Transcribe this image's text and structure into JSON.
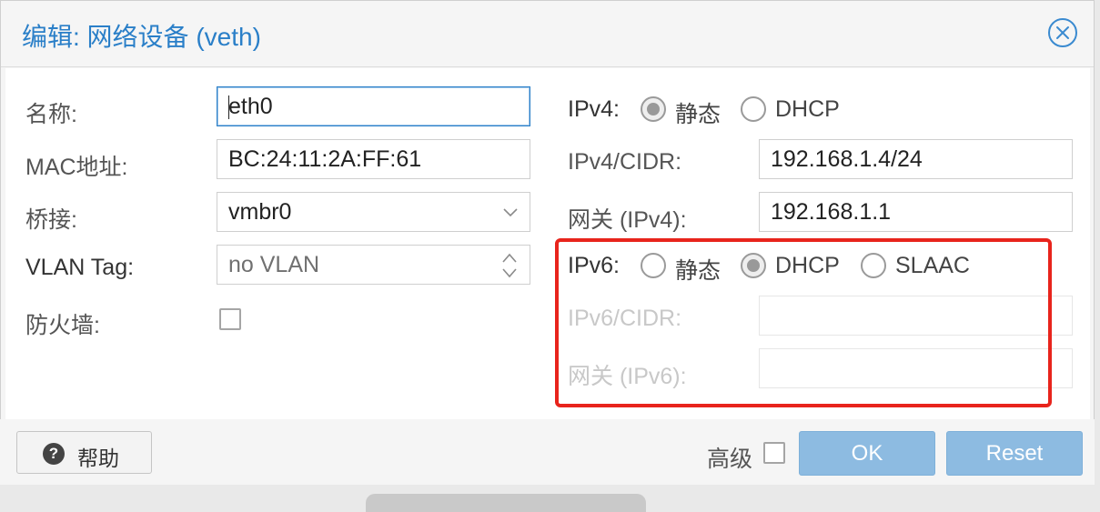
{
  "dialog": {
    "title": "编辑: 网络设备 (veth)"
  },
  "left": {
    "name_label": "名称:",
    "name_value": "eth0",
    "mac_label": "MAC地址:",
    "mac_value": "BC:24:11:2A:FF:61",
    "bridge_label": "桥接:",
    "bridge_value": "vmbr0",
    "vlan_label": "VLAN Tag:",
    "vlan_placeholder": "no VLAN",
    "firewall_label": "防火墙:",
    "firewall_checked": false
  },
  "ipv4": {
    "label": "IPv4:",
    "options": [
      "静态",
      "DHCP"
    ],
    "selected": "静态",
    "cidr_label": "IPv4/CIDR:",
    "cidr_value": "192.168.1.4/24",
    "gateway_label": "网关 (IPv4):",
    "gateway_value": "192.168.1.1"
  },
  "ipv6": {
    "label": "IPv6:",
    "options": [
      "静态",
      "DHCP",
      "SLAAC"
    ],
    "selected": "DHCP",
    "cidr_label": "IPv6/CIDR:",
    "cidr_value": "",
    "gateway_label": "网关 (IPv6):",
    "gateway_value": ""
  },
  "footer": {
    "help_label": "帮助",
    "advanced_label": "高级",
    "advanced_checked": false,
    "ok_label": "OK",
    "reset_label": "Reset"
  },
  "colors": {
    "title": "#2a7fc8",
    "highlight_box": "#e8241c",
    "primary_button": "#8dbbe1"
  }
}
